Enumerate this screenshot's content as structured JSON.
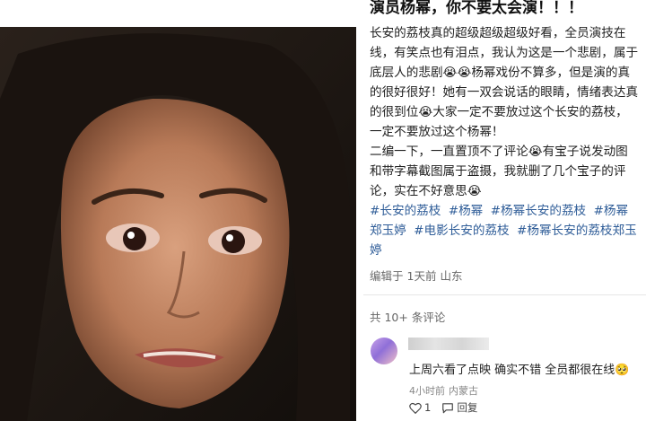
{
  "post": {
    "title": "演员杨幂，你不要太会演！！！",
    "paragraphs": [
      "长安的荔枝真的超级超级超级好看，全员演技在线，有笑点也有泪点，我认为这是一个悲剧，属于底层人的悲剧😭😭杨幂戏份不算多，但是演的真的很好很好！她有一双会说话的眼睛，情绪表达真的很到位😭大家一定不要放过这个长安的荔枝，一定不要放过这个杨幂！",
      "二编一下，一直置顶不了评论😭有宝子说发动图和带字幕截图属于盗摄，我就删了几个宝子的评论，实在不好意思😭"
    ],
    "tags": [
      "#长安的荔枝",
      "#杨幂",
      "#杨幂长安的荔枝",
      "#杨幂郑玉婷",
      "#电影长安的荔枝",
      "#杨幂长安的荔枝郑玉婷"
    ],
    "meta": {
      "edited": "编辑于",
      "time": "1天前",
      "location": "山东"
    }
  },
  "comments_header": "共 10+ 条评论",
  "comment": {
    "text": "上周六看了点映 确实不错 全员都很在线🥺",
    "time": "4小时前",
    "location": "内蒙古",
    "likes": "1",
    "reply": "回复"
  },
  "colors": {
    "tag": "#2f5d98",
    "meta": "#6a6a6a"
  },
  "icons": [
    "heart-icon",
    "reply-icon"
  ]
}
